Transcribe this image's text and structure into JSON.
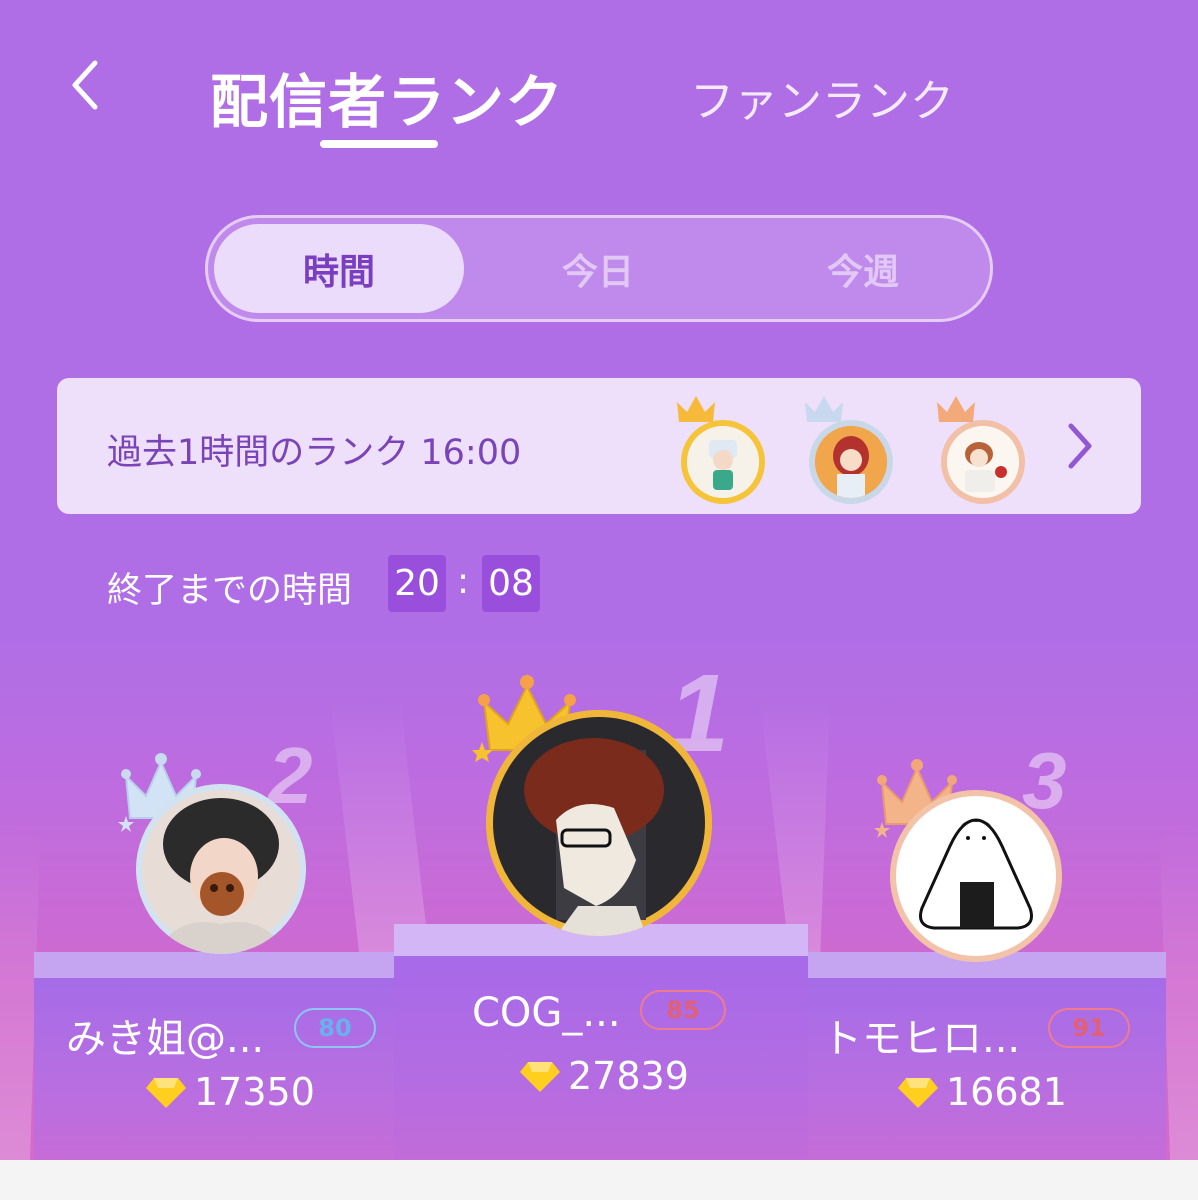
{
  "header": {
    "tab_streamer": "配信者ランク",
    "tab_fan": "ファンランク"
  },
  "segment": {
    "hour": "時間",
    "today": "今日",
    "week": "今週"
  },
  "past_hour": {
    "title": "過去1時間のランク 16:00"
  },
  "timer": {
    "label": "終了までの時間",
    "minutes": "20",
    "colon": ":",
    "seconds": "08"
  },
  "podium": {
    "first": {
      "rank": "1",
      "name": "COG_...",
      "level": "85",
      "score": "27839"
    },
    "second": {
      "rank": "2",
      "name": "みき姐@...",
      "level": "80",
      "score": "17350"
    },
    "third": {
      "rank": "3",
      "name": "トモヒロ...",
      "level": "91",
      "score": "16681"
    }
  },
  "colors": {
    "background": "#b06ee6",
    "accent_dark": "#7a3ec0",
    "level_blue": "#5aa6ee",
    "level_red": "#e0607a",
    "gem": "#ffcf1f"
  },
  "icons": [
    "back-icon",
    "chevron-right-icon",
    "crown-icon",
    "diamond-icon"
  ]
}
